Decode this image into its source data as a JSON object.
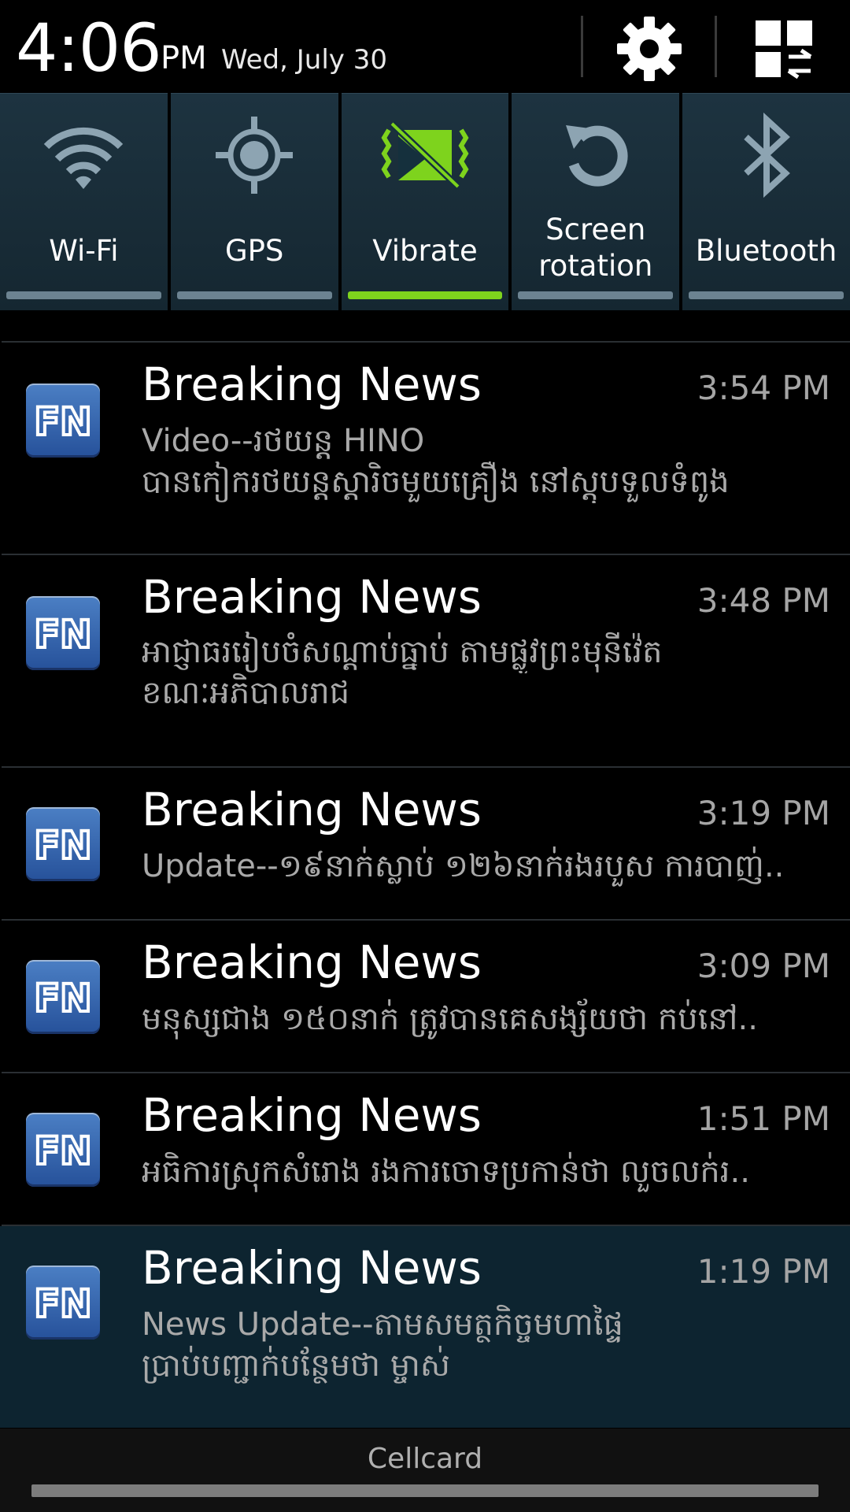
{
  "header": {
    "time": "4:06",
    "ampm": "PM",
    "date": "Wed, July 30",
    "settings_icon": "gear-icon",
    "quick_panel_icon": "grid-toggle-icon"
  },
  "quick_settings": [
    {
      "label": "Wi-Fi",
      "icon": "wifi-icon",
      "active": false
    },
    {
      "label": "GPS",
      "icon": "gps-icon",
      "active": false
    },
    {
      "label": "Vibrate",
      "icon": "vibrate-icon",
      "active": true
    },
    {
      "label": "Screen rotation",
      "label_line1": "Screen",
      "label_line2": "rotation",
      "icon": "rotation-icon",
      "active": false
    },
    {
      "label": "Bluetooth",
      "icon": "bluetooth-icon",
      "active": false
    }
  ],
  "notifications": [
    {
      "title": "Breaking News",
      "time": "3:54 PM",
      "line1": "Video--រថយន្ត HINO",
      "line2": "បានកៀករថយន្តស្ដារិចមួយគ្រឿង នៅស្តុបទួលទំពូង",
      "ongoing": false
    },
    {
      "title": "Breaking News",
      "time": "3:48 PM",
      "line1": "អាជ្ញាធររៀបចំសណ្ដាប់ធ្នាប់ តាមផ្លូវព្រះមុនីវ៉េត",
      "line2": "ខណៈអភិបាលរាជ",
      "ongoing": false
    },
    {
      "title": "Breaking News",
      "time": "3:19 PM",
      "line1": "Update--១៩នាក់ស្លាប់ ១២៦នាក់រងរបួស ការបាញ់..",
      "ongoing": false
    },
    {
      "title": "Breaking News",
      "time": "3:09 PM",
      "line1": "មនុស្សជាង ១៥០នាក់ ត្រូវបានគេសង្ស័យថា កប់នៅ..",
      "ongoing": false
    },
    {
      "title": "Breaking News",
      "time": "1:51 PM",
      "line1": "អធិការស្រុកសំរោង រងការចោទប្រកាន់ថា លួចលក់រ..",
      "ongoing": false
    },
    {
      "title": "Breaking News",
      "time": "1:19 PM",
      "line1": "News Update--តាមសមត្ថកិច្ចមហាផ្ទៃ",
      "line2": "ប្រាប់បញ្ជាក់បន្ថែមថា ម្ចាស់",
      "ongoing": true
    }
  ],
  "app_icon_text": "FN",
  "footer": {
    "carrier": "Cellcard"
  },
  "colors": {
    "accent_green": "#7ed31d",
    "tile_bg": "#1a2e39",
    "bar_off": "#6c8391"
  }
}
